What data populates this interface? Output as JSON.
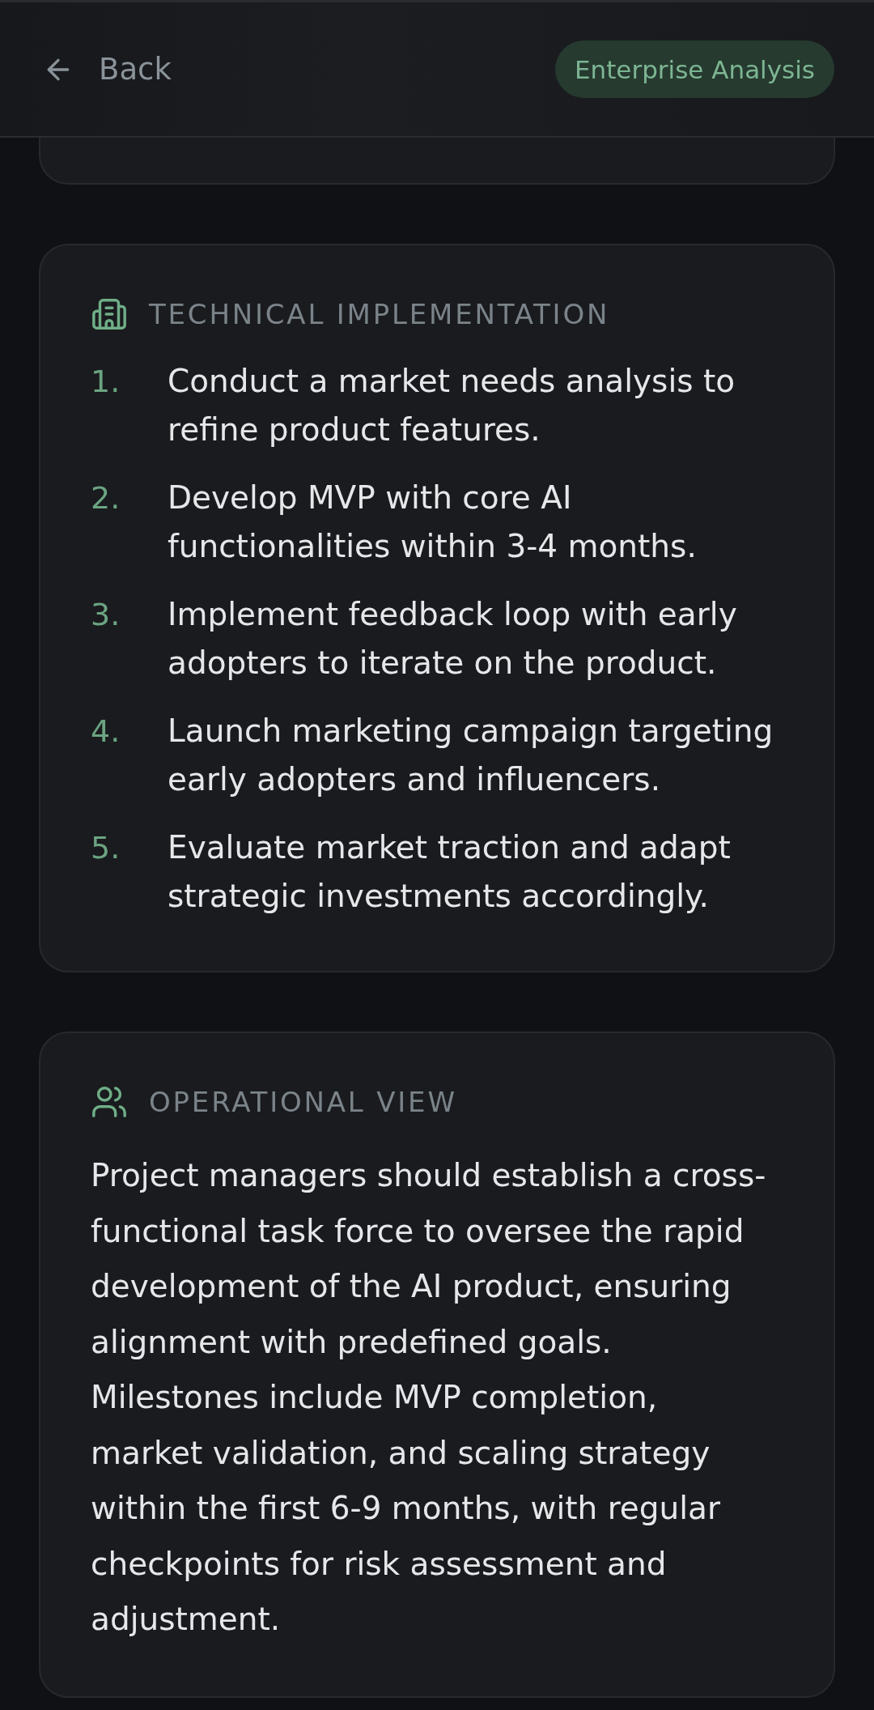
{
  "header": {
    "back_label": "Back",
    "badge": "Enterprise Analysis"
  },
  "sections": [
    {
      "kind": "list",
      "title": "TECHNICAL IMPLEMENTATION",
      "items": [
        {
          "number": "1.",
          "text": "Conduct a market needs analysis to refine product features."
        },
        {
          "number": "2.",
          "text": "Develop MVP with core AI functionalities within 3-4 months."
        },
        {
          "number": "3.",
          "text": "Implement feedback loop with early adopters to iterate on the product."
        },
        {
          "number": "4.",
          "text": "Launch marketing campaign targeting early adopters and influencers."
        },
        {
          "number": "5.",
          "text": "Evaluate market traction and adapt strategic investments accordingly."
        }
      ]
    },
    {
      "kind": "paragraph",
      "title": "OPERATIONAL VIEW",
      "text": "Project managers should establish a cross-functional task force to oversee the rapid development of the AI product, ensuring alignment with predefined goals. Milestones include MVP completion, market validation, and scaling strategy within the first 6-9 months, with regular checkpoints for risk assessment and adjustment."
    }
  ]
}
